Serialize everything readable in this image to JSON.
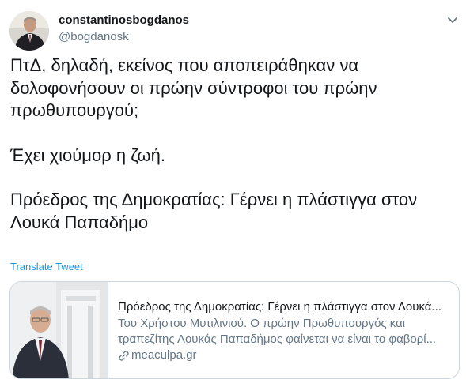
{
  "author": {
    "display_name": "constantinosbogdanos",
    "handle": "@bogdanosk",
    "avatar_icon": "person-avatar"
  },
  "tweet": {
    "paragraphs": [
      [
        "ΠτΔ, δηλαδή, εκείνος που αποπειράθηκαν να",
        "δολοφονήσουν οι πρώην σύντροφοι του πρώην",
        "πρωθυπουργού;"
      ],
      [
        "Έχει χιούμορ η ζωή."
      ],
      [
        "Πρόεδρος της Δημοκρατίας: Γέρνει η πλάστιγγα στον",
        "Λουκά Παπαδήμο"
      ]
    ],
    "translate_label": "Translate Tweet"
  },
  "card": {
    "title": "Πρόεδρος της Δημοκρατίας: Γέρνει η πλάστιγγα στον Λουκά...",
    "description_line1": "Του Χρήστου Μυτιλινιού. Ο πρώην Πρωθυπουργός και",
    "description_line2": "τραπεζίτης Λουκάς Παπαδήμος φαίνεται να είναι το φαβορί...",
    "domain": "meaculpa.gr",
    "link_icon": "link-icon"
  },
  "colors": {
    "accent": "#1b95e0",
    "text": "#14171a",
    "secondary": "#657786",
    "border": "#ccd6dd"
  }
}
